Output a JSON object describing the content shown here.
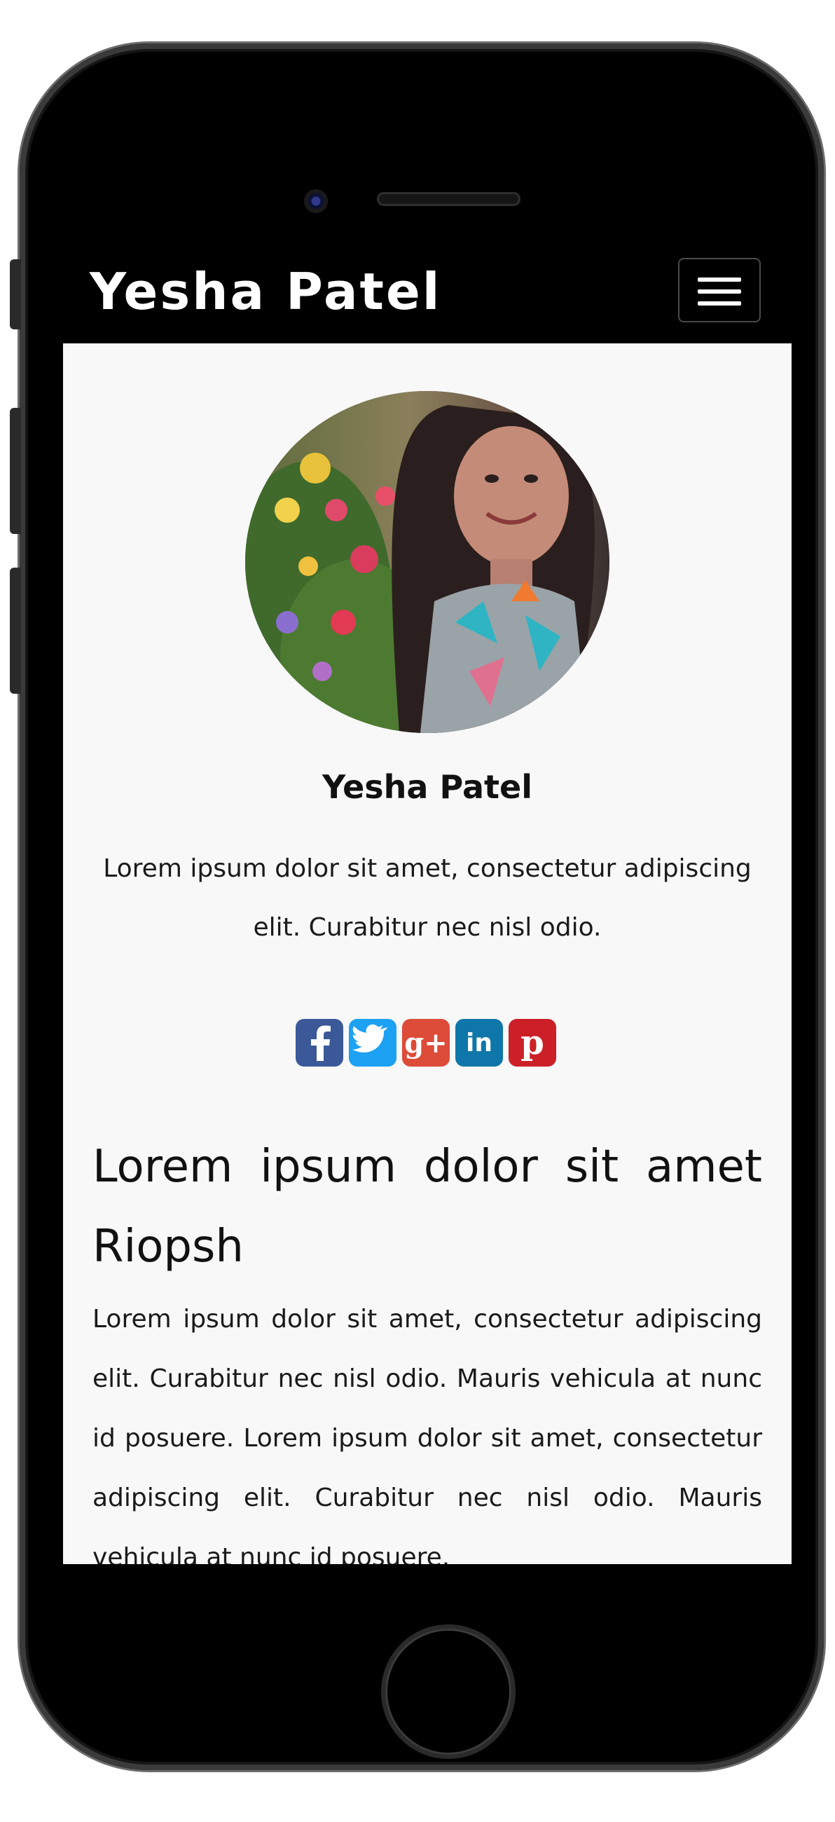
{
  "navbar": {
    "brand": "Yesha Patel",
    "menu_icon": "hamburger-icon"
  },
  "profile": {
    "name": "Yesha Patel",
    "intro": "Lorem ipsum dolor sit amet, consectetur adipiscing elit. Curabitur nec nisl odio."
  },
  "social": [
    {
      "name": "facebook",
      "color": "#3b5998"
    },
    {
      "name": "twitter",
      "color": "#1da1f2"
    },
    {
      "name": "google-plus",
      "color": "#dd4b39"
    },
    {
      "name": "linkedin",
      "color": "#0e76a8"
    },
    {
      "name": "pinterest",
      "color": "#cb2027"
    }
  ],
  "article": {
    "heading": "Lorem ipsum dolor sit amet Riopsh",
    "body": "Lorem ipsum dolor sit amet, consectetur adipiscing elit. Curabitur nec nisl odio. Mauris vehicula at nunc id posuere. Lorem ipsum dolor sit amet, consectetur adipiscing elit. Curabitur nec nisl odio. Mauris vehicula at nunc id posuere."
  }
}
